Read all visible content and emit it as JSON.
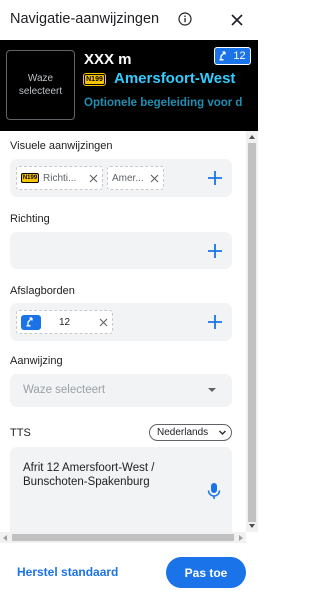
{
  "header": {
    "title": "Navigatie-aanwijzingen"
  },
  "preview": {
    "image_placeholder": "Waze selecteert",
    "distance": "XXX m",
    "exit_number": "12",
    "road_shield": "N199",
    "road_name": "Amersfoort-West",
    "subtitle": "Optionele begeleiding voor d"
  },
  "sections": {
    "visual": {
      "label": "Visuele aanwijzingen",
      "chips": [
        {
          "shield": "N199",
          "text": "Richti..."
        },
        {
          "text": "Amer..."
        }
      ]
    },
    "direction": {
      "label": "Richting"
    },
    "signs": {
      "label": "Afslagborden",
      "chip_value": "12"
    },
    "instruction": {
      "label": "Aanwijzing",
      "placeholder": "Waze selecteert"
    },
    "tts": {
      "label": "TTS",
      "language": "Nederlands",
      "text": "Afrit 12 Amersfoort-West / Bunschoten-Spakenburg"
    }
  },
  "footer": {
    "reset_label": "Herstel standaard",
    "apply_label": "Pas toe"
  },
  "colors": {
    "accent": "#1a73e8",
    "road_name": "#33ccff",
    "subtitle": "#1e8fb3",
    "shield_yellow": "#f6c500"
  }
}
